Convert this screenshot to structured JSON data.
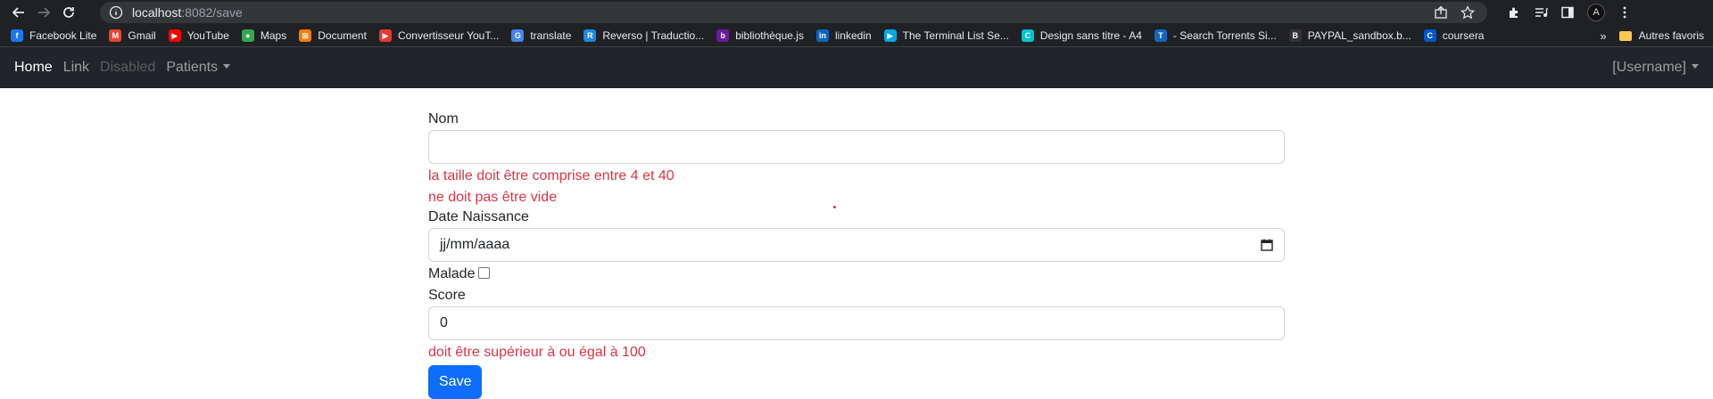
{
  "browser": {
    "url_host": "localhost",
    "url_port_path": ":8082/save",
    "bookmarks": [
      {
        "label": "Facebook Lite",
        "icon": "facebook-icon",
        "color": "#1877f2",
        "glyph": "f"
      },
      {
        "label": "Gmail",
        "icon": "gmail-icon",
        "color": "#ea4335",
        "glyph": "M"
      },
      {
        "label": "YouTube",
        "icon": "youtube-icon",
        "color": "#ff0000",
        "glyph": "▶"
      },
      {
        "label": "Maps",
        "icon": "maps-icon",
        "color": "#34a853",
        "glyph": "●"
      },
      {
        "label": "Document",
        "icon": "document-icon",
        "color": "#f57c00",
        "glyph": "⊠"
      },
      {
        "label": "Convertisseur YouT...",
        "icon": "youtube-converter-icon",
        "color": "#e53935",
        "glyph": "▶"
      },
      {
        "label": "translate",
        "icon": "translate-icon",
        "color": "#4285f4",
        "glyph": "G"
      },
      {
        "label": "Reverso | Traductio...",
        "icon": "reverso-icon",
        "color": "#1e88e5",
        "glyph": "R"
      },
      {
        "label": "bibliothèque.js",
        "icon": "js-library-icon",
        "color": "#6a1b9a",
        "glyph": "b"
      },
      {
        "label": "linkedin",
        "icon": "linkedin-icon",
        "color": "#0a66c2",
        "glyph": "in"
      },
      {
        "label": "The Terminal List Se...",
        "icon": "prime-video-icon",
        "color": "#00a8e1",
        "glyph": "▶"
      },
      {
        "label": "Design sans titre - A4",
        "icon": "canva-icon",
        "color": "#00c4cc",
        "glyph": "C"
      },
      {
        "label": "- Search Torrents Si...",
        "icon": "torrent-icon",
        "color": "#1565c0",
        "glyph": "T"
      },
      {
        "label": "PAYPAL_sandbox.b...",
        "icon": "paypal-icon",
        "color": "#333333",
        "glyph": "B"
      },
      {
        "label": "coursera",
        "icon": "coursera-icon",
        "color": "#0056d2",
        "glyph": "C"
      }
    ],
    "more_bookmarks": "»",
    "other_bookmarks": "Autres favoris",
    "profile_initial": "A"
  },
  "navbar": {
    "home": "Home",
    "link": "Link",
    "disabled": "Disabled",
    "patients": "Patients",
    "username": "[Username]"
  },
  "form": {
    "nom_label": "Nom",
    "nom_value": "",
    "nom_error_1": "la taille doit être comprise entre 4 et 40",
    "nom_error_2": "ne doit pas être vide",
    "date_label": "Date Naissance",
    "date_placeholder": "jj/mm/aaaa",
    "malade_label": "Malade",
    "malade_checked": false,
    "score_label": "Score",
    "score_value": "0",
    "score_error": "doit être supérieur à ou égal à 100",
    "save_label": "Save"
  }
}
